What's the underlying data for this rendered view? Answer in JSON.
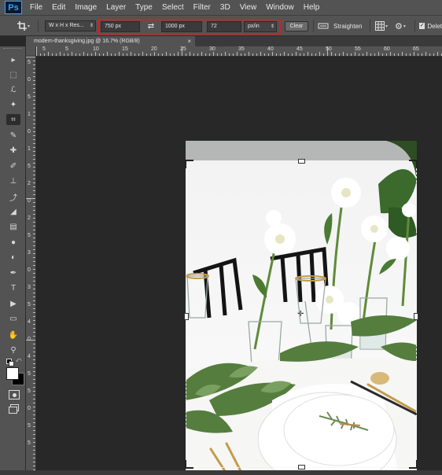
{
  "app": {
    "logo": "Ps"
  },
  "menu": [
    "File",
    "Edit",
    "Image",
    "Layer",
    "Type",
    "Select",
    "Filter",
    "3D",
    "View",
    "Window",
    "Help"
  ],
  "options": {
    "tool_icon": "crop-icon",
    "ratio_preset": "W x H x Res...",
    "width": "750 px",
    "height": "1000 px",
    "resolution": "72",
    "resolution_unit": "px/in",
    "clear_label": "Clear",
    "straighten_label": "Straighten",
    "delete_label": "Delet"
  },
  "document": {
    "tab_title": "modern-thanksgiving.jpg @ 16.7% (RGB/8)"
  },
  "ruler": {
    "top_labels": [
      "5",
      "5",
      "10",
      "15",
      "20",
      "25",
      "30",
      "35",
      "40",
      "45",
      "50",
      "55",
      "60",
      "65"
    ],
    "left_labels": [
      "5",
      "0",
      "5",
      "1",
      "0",
      "1",
      "5",
      "2",
      "0",
      "2",
      "5",
      "3",
      "0",
      "3",
      "5",
      "4",
      "0",
      "4",
      "5",
      "5",
      "0",
      "5",
      "5"
    ]
  },
  "tools": [
    "move-tool-icon",
    "marquee-tool-icon",
    "lasso-tool-icon",
    "magic-wand-tool-icon",
    "crop-tool-icon",
    "eyedropper-tool-icon",
    "healing-brush-tool-icon",
    "brush-tool-icon",
    "clone-stamp-tool-icon",
    "history-brush-tool-icon",
    "eraser-tool-icon",
    "gradient-tool-icon",
    "blur-tool-icon",
    "dodge-tool-icon",
    "pen-tool-icon",
    "type-tool-icon",
    "path-selection-tool-icon",
    "rectangle-tool-icon",
    "hand-tool-icon",
    "zoom-tool-icon"
  ],
  "tool_glyphs": [
    "▸",
    "⬚",
    "ℒ",
    "✦",
    "⌗",
    "✎",
    "✚",
    "✐",
    "⊥",
    "⤴",
    "◢",
    "▤",
    "●",
    "◐",
    "✒",
    "T",
    "▶",
    "▭",
    "✋",
    "⚲"
  ],
  "colors": {
    "chrome": "#535353",
    "canvas_bg": "#282828",
    "highlight": "#c8242c"
  }
}
